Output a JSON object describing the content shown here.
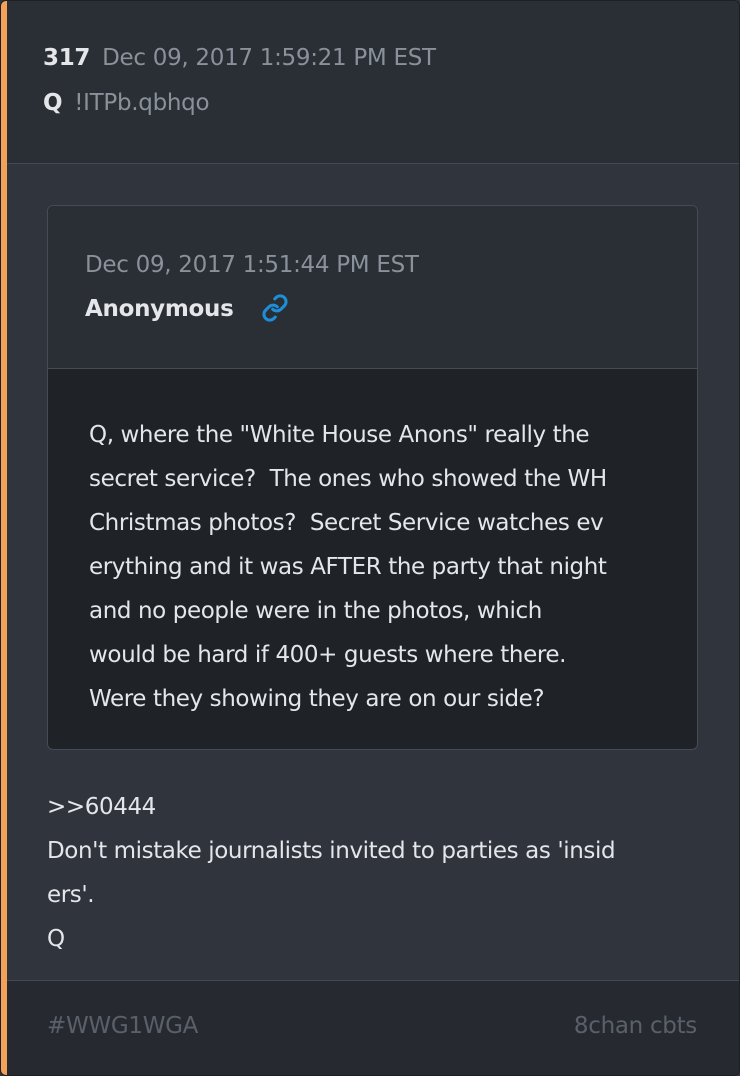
{
  "post": {
    "number": "317",
    "timestamp": "Dec 09, 2017 1:59:21 PM EST",
    "author": "Q",
    "tripcode": "!ITPb.qbhqo",
    "accent_color": "#f4a259"
  },
  "quoted_post": {
    "timestamp": "Dec 09, 2017 1:51:44 PM EST",
    "author": "Anonymous",
    "link_icon": "link-icon",
    "link_color": "#1e8fd6",
    "text": "Q, where the \"White House Anons\" really the\nsecret service?  The ones who showed the WH\nChristmas photos?  Secret Service watches ev\nerything and it was AFTER the party that night\nand no people were in the photos, which\nwould be hard if 400+ guests where there.\nWere they showing they are on our side?"
  },
  "reply": {
    "text": ">>60444\nDon't mistake journalists invited to parties as 'insid\ners'.\nQ"
  },
  "footer": {
    "hashtag": "#WWG1WGA",
    "source": "8chan cbts"
  }
}
